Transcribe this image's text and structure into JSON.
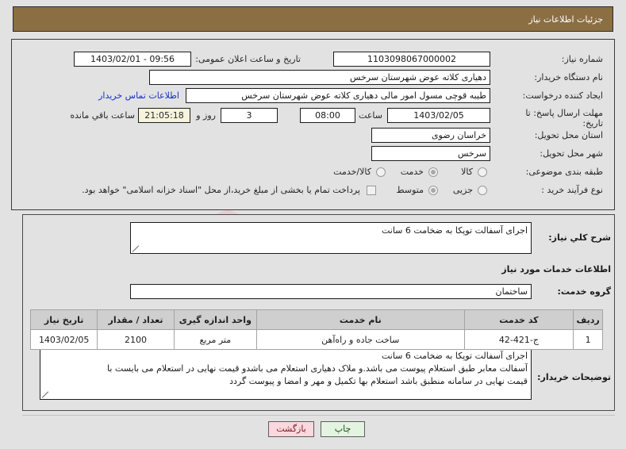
{
  "header": {
    "title": "جزئیات اطلاعات نیاز"
  },
  "watermark": {
    "text": "AriaTender.net"
  },
  "form": {
    "need_number": {
      "label": "شماره نیاز:",
      "value": "1103098067000002"
    },
    "public_announce": {
      "label": "تاریخ و ساعت اعلان عمومی:",
      "value": "09:56 - 1403/02/01"
    },
    "buyer_org": {
      "label": "نام دستگاه خریدار:",
      "value": "دهیاری کلاته عوض شهرستان سرخس"
    },
    "request_creator": {
      "label": "ایجاد کننده درخواست:",
      "value": "طیبه قوچی مسول امور مالی دهیاری کلاته عوض شهرستان سرخس"
    },
    "buyer_contact_link": "اطلاعات تماس خریدار",
    "deadline": {
      "label_line1": "مهلت ارسال پاسخ: تا",
      "label_line2": "تاریخ:",
      "date": "1403/02/05",
      "hour_label": "ساعت",
      "hour": "08:00",
      "days": "3",
      "days_suffix": "روز و",
      "countdown": "21:05:18",
      "countdown_suffix": "ساعت باقي مانده"
    },
    "delivery_province": {
      "label": "استان محل تحویل:",
      "value": "خراسان رضوی"
    },
    "delivery_city": {
      "label": "شهر محل تحویل:",
      "value": "سرخس"
    },
    "subject_class": {
      "label": "طبقه بندی موضوعی:",
      "options": [
        {
          "label": "کالا",
          "selected": false
        },
        {
          "label": "خدمت",
          "selected": true
        },
        {
          "label": "کالا/خدمت",
          "selected": false
        }
      ]
    },
    "purchase_process": {
      "label": "نوع فرآیند خرید :",
      "options": [
        {
          "label": "جزیی",
          "selected": false
        },
        {
          "label": "متوسط",
          "selected": true
        }
      ],
      "treasury_checkbox": {
        "label": "پرداخت تمام یا بخشی از مبلغ خرید،از محل \"اسناد خزانه اسلامی\" خواهد بود.",
        "checked": false
      }
    },
    "general_desc": {
      "label": "شرح کلي نیاز:",
      "value": "اجرای آسفالت توپکا به ضخامت 6 سانت"
    },
    "services_section_title": "اطلاعات خدمات مورد نیاز",
    "service_group": {
      "label": "گروه خدمت:",
      "value": "ساختمان"
    },
    "buyer_notes": {
      "label": "توضیحات خریدار:",
      "lines": [
        "اجرای آسفالت توپکا به ضخامت 6 سانت",
        "آسفالت معابر طبق استعلام  پیوست می باشد.و ملاک  دهیاری استعلام  می باشدو قیمت نهایی در استعلام می بایست با",
        "قیمت  نهایی در سامانه  منطبق باشد استعلام  بها  تکمیل  و مهر و امضا و پیوست  گردد"
      ]
    }
  },
  "table": {
    "columns": [
      "ردیف",
      "کد خدمت",
      "نام خدمت",
      "واحد اندازه گیری",
      "تعداد / مقدار",
      "تاریخ نیاز"
    ],
    "rows": [
      {
        "index": "1",
        "service_code": "ج-421-42",
        "service_name": "ساخت جاده و راه‌آهن",
        "unit": "متر مربع",
        "quantity": "2100",
        "need_date": "1403/02/05"
      }
    ]
  },
  "buttons": {
    "print": "چاپ",
    "back": "بازگشت"
  },
  "colors": {
    "header_bg": "#8c6e43",
    "countdown_bg": "#f7f3dc",
    "print_bg": "#e3f4e1",
    "back_bg": "#fad8dd",
    "link": "#1430c4"
  }
}
